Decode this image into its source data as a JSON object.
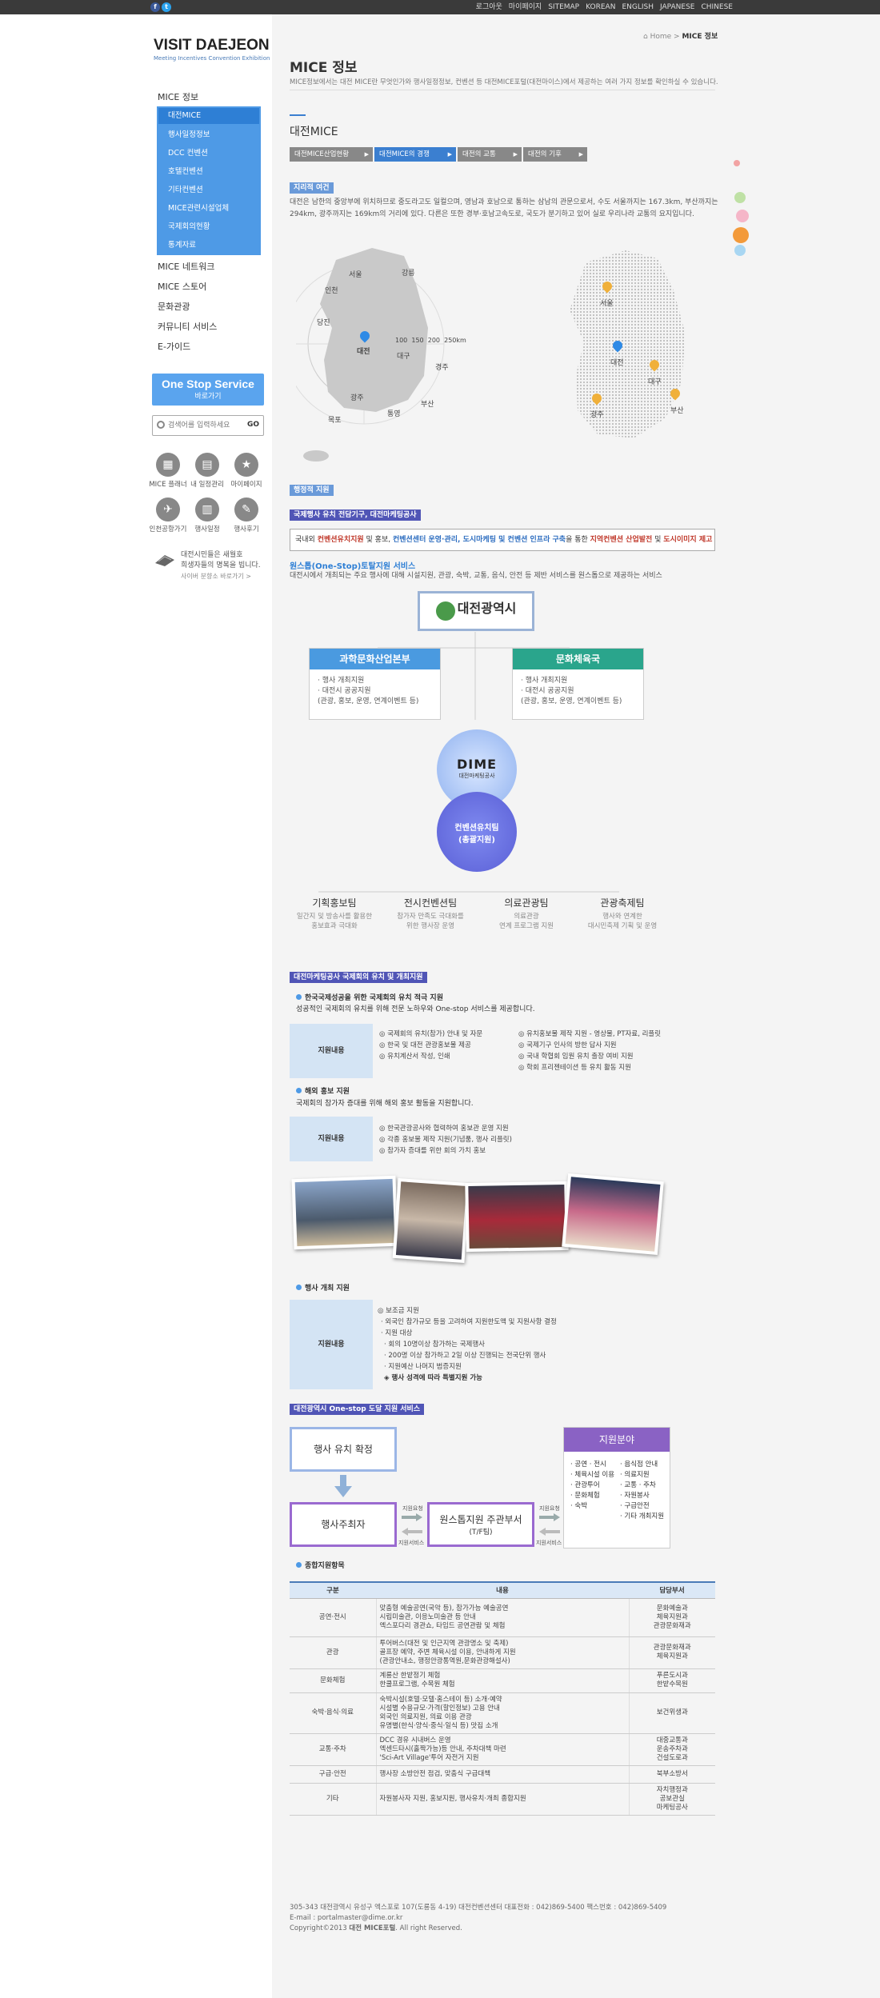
{
  "topbar": {
    "links": [
      "로그아웃",
      "마이페이지",
      "SITEMAP",
      "KOREAN",
      "ENGLISH",
      "JAPANESE",
      "CHINESE"
    ],
    "fb": "f",
    "tw": "t"
  },
  "logo": {
    "title": "VISIT DAEJEON",
    "subtitle": "Meeting Incentives Convention Exhibition"
  },
  "nav": {
    "main": [
      {
        "label": "MICE 정보"
      },
      {
        "label": "MICE 네트워크"
      },
      {
        "label": "MICE 스토어"
      },
      {
        "label": "문화관광"
      },
      {
        "label": "커뮤니티 서비스"
      },
      {
        "label": "E-가이드"
      }
    ],
    "sub": [
      "대전MICE",
      "행사일정정보",
      "DCC 컨벤션",
      "호텔컨벤션",
      "기타컨벤션",
      "MICE관련시설업체",
      "국제회의현황",
      "통계자료"
    ]
  },
  "oss": {
    "title": "One Stop Service",
    "sub": "바로가기"
  },
  "search": {
    "placeholder": "검색어를 입력하세요",
    "go": "GO"
  },
  "quick": [
    {
      "label": "MICE 플래너",
      "icon": "planner-icon"
    },
    {
      "label": "내 일정관리",
      "icon": "schedule-icon"
    },
    {
      "label": "마이페이지",
      "icon": "star-icon"
    },
    {
      "label": "인천공항가기",
      "icon": "plane-icon"
    },
    {
      "label": "행사일정",
      "icon": "calendar-icon"
    },
    {
      "label": "행사후기",
      "icon": "pen-icon"
    }
  ],
  "sidepromo": {
    "l1": "대전시민들은 새월호",
    "l2": "희생자들의 명복을 빕니다.",
    "more": "사이버 분향소 바로가기 >"
  },
  "breadcrumb": {
    "home": "Home",
    "sep": ">",
    "current": "MICE 정보"
  },
  "page": {
    "title": "MICE 정보",
    "desc": "MICE정보에서는 대전 MICE란 무엇인가와 행사일정정보, 컨벤션 등 대전MICE포털(대전마이스)에서 제공하는 여러 가지 정보를 확인하실 수 있습니다.",
    "section": "대전MICE"
  },
  "tabs": [
    "대전MICE산업현황",
    "대전MICE의 경쟁",
    "대전의 교통",
    "대전의 기후"
  ],
  "geo": {
    "badge": "지리적 여건",
    "text1": "대전은 남한의 중앙부에 위치하므로 중도라고도 일컬으며, 영남과 호남으로 통하는 삼남의 관문으로서, 수도 서울까지는 167.3km, 부산까지는",
    "text2": "294km, 광주까지는 169km의 거리에 있다. 다른은 또한 경부·호남고속도로, 국도가 분기하고 있어 실로 우리나라 교통의 요지입니다.",
    "cities1": [
      "서울",
      "강릉",
      "인천",
      "당진",
      "대전",
      "대구",
      "경주",
      "광주",
      "부산",
      "통영",
      "목포"
    ],
    "rings": [
      "100",
      "150",
      "200",
      "250km"
    ],
    "cities2": [
      "서울",
      "대전",
      "대구",
      "광주",
      "부산"
    ]
  },
  "admin": {
    "badge": "행정적 지원",
    "title": "국제행사 유치 전담기구, 대전마케팅공사",
    "box": {
      "a": "국내외 ",
      "b": "컨벤션유치지원",
      "c": " 및 홍보, ",
      "d": "컨벤션센터 운영·관리, 도시마케팅 및 컨벤션 인프라 구축",
      "e": "을 통한 ",
      "f": "지역컨벤션 산업발전",
      "g": " 및 ",
      "h": "도시이미지 제고"
    },
    "ossTitle": "원스톱(One-Stop)토탈지원 서비스",
    "ossDesc": "대전시에서 개최되는 주요 행사에 대해 시설지원, 관광, 숙박, 교통, 음식, 안전 등 제반 서비스를 원스톱으로 제공하는 서비스"
  },
  "org": {
    "top": "대전광역시",
    "left": {
      "title": "과학문화산업본부",
      "items": [
        "· 행사 개최지원",
        "· 대전시 공공지원",
        "(관광, 홍보, 운영, 연계이벤트 등)"
      ]
    },
    "right": {
      "title": "문화체육국",
      "items": [
        "· 행사 개최지원",
        "· 대전시 공공지원",
        "(관광, 홍보, 운영, 연계이벤트 등)"
      ]
    },
    "dime": "DIME",
    "dimesub": "대전마케팅공사",
    "center1": "컨벤션유치팀",
    "center2": "(총괄지원)",
    "teams": [
      {
        "n": "기획홍보팀",
        "d1": "일간지 및 방송사를 활용한",
        "d2": "홍보효과 극대화"
      },
      {
        "n": "전시컨벤션팀",
        "d1": "참가자 만족도 극대화를",
        "d2": "위한 행사장 운영"
      },
      {
        "n": "의료관광팀",
        "d1": "의료관광",
        "d2": "연계 프로그램 지원"
      },
      {
        "n": "관광축제팀",
        "d1": "행사와 연계한",
        "d2": "대시민축제 기획 및 운영"
      }
    ]
  },
  "intl": {
    "badge": "대전마케팅공사 국제회의 유치 및 개최지원",
    "s1": {
      "title": "한국국제성공을 위한 국제회의 유치 적극 지원",
      "desc": "성공적인 국제회의 유치를 위해 전문 노하우와 One-stop 서비스를 제공합니다.",
      "label": "지원내용",
      "colA": [
        "◎ 국제회의 유치(참가) 안내 및 자문",
        "◎ 한국 및 대전 관광홍보물 제공",
        "◎ 유치계산서 작성, 인쇄"
      ],
      "colB": [
        "◎ 유치홍보물 제작 지원 - 영상물, PT자료, 리플릿",
        "◎ 국제기구 인사의 방한 답사 지원",
        "◎ 국내 학협회 임원 유치 출장 여비 지원",
        "◎ 학회 프리젠테이션 등 유치 활동 지원"
      ]
    },
    "s2": {
      "title": "해외 홍보 지원",
      "desc": "국제회의 참가자 증대를 위해 해외 홍보 활동을 지원합니다.",
      "label": "지원내용",
      "items": [
        "◎ 한국관광공사와 협력하여 홍보관 운영 지원",
        "◎ 각종 홍보물 제작 지원(기념품, 행사 리플릿)",
        "◎ 참가자 증대를 위한 회의 가치 홍보"
      ]
    },
    "s3": {
      "title": "행사 개최 지원",
      "label": "지원내용",
      "items": [
        "◎ 보조금 지원",
        "· 외국인 참가규모 등을 고려하여 지원한도액 및 지원사항 결정",
        "· 지원 대상",
        "· 회의 10명이상 참가하는 국제행사",
        "· 200명 이상 참가하고 2일 이상 진행되는 전국단위 행사",
        "· 지원예산 나머지 범증지원",
        "◈ 행사 성격에 따라 특별지원 가능"
      ]
    }
  },
  "flowsec": {
    "badge": "대전광역시 One-stop 도달 지원 서비스",
    "b1": "행사 유치 확정",
    "b2": "행사주최자",
    "b3": "원스톱지원 주관부서",
    "b3s": "(T/F팀)",
    "b4": "지원분야",
    "l1": "지원요청",
    "l2": "지원서비스",
    "l3": "지원요청",
    "l4": "지원서비스",
    "listA": [
      "· 공연 · 전시",
      "· 체육시설 이용",
      "· 관광투어",
      "· 문화체험",
      "· 숙박"
    ],
    "listB": [
      "· 음식점 안내",
      "· 의료지원",
      "· 교통 · 주차",
      "· 자원봉사",
      "· 구급안전",
      "· 기타 개최지원"
    ]
  },
  "table": {
    "title": "종합지원항목",
    "headers": [
      "구분",
      "내용",
      "담당부서"
    ],
    "rows": [
      {
        "cat": "공연·전시",
        "lines": [
          "맞춤형 예술공연(국악 등), 참가가능 예술공연",
          "시립미술관, 이응노미술관 등 안내",
          "엑스포다리 경관쇼, 타임드 공연관람 및 체험"
        ],
        "dept": [
          "문화예술과",
          "체육지원과",
          "관광문화재과"
        ]
      },
      {
        "cat": "관광",
        "lines": [
          "투어버스(대전 및 인근지역 관광명소 및 축제)",
          "골프장 예약, 주변 체육시설 이용, 안내하게 지원",
          "(관광안내소, 행정안광통역원,문화관광해설사)"
        ],
        "dept": [
          "관광문화재과",
          "체육지원과"
        ]
      },
      {
        "cat": "문화체험",
        "lines": [
          "계룡산 한밭정기 체험",
          "한쿨프로그램, 수목원 체험"
        ],
        "dept": [
          "푸른도시과",
          "한밭수목원"
        ]
      },
      {
        "cat": "숙박·음식·의료",
        "lines": [
          "숙박시설(호텔·모텔·홈스테이 등) 소개·예약",
          "시설별 수용규모·가격(할인정보) 고용 안내",
          "외국인 의료지원, 의료 이용 관광",
          "유명별(한식·양식·중식·일식 등) 맛집 소개"
        ],
        "dept": [
          "보건위생과"
        ]
      },
      {
        "cat": "교통·주차",
        "lines": [
          "DCC 경유 시내버스 운영",
          "엑센드타시(홀짝가능)등 안내, 주차대책 마련",
          "'Sci-Art Village'투어 자전거 지원"
        ],
        "dept": [
          "대중교통과",
          "운송주차과",
          "건설도로과"
        ]
      },
      {
        "cat": "구급·안전",
        "lines": [
          "행사장 소방안전 점검, 맞춤식 구급대책"
        ],
        "dept": [
          "북부소방서"
        ]
      },
      {
        "cat": "기타",
        "lines": [
          "자원봉사자 지원, 홍보지원, 행사유치·개최 종합지원"
        ],
        "dept": [
          "자치행정과",
          "공보관실",
          "마케팅공사"
        ]
      }
    ]
  },
  "footer": {
    "l1": "305-343 대전광역시 유성구 엑스포로 107(도룡동 4-19) 대전컨벤션센터 대표전화 : 042)869-5400 팩스번호 : 042)869-5409",
    "l2": "E-mail : portalmaster@dime.or.kr",
    "l3a": "Copyright©2013 ",
    "l3b": "대전 MICE포털",
    "l3c": ". All right Reserved."
  },
  "colors": {
    "accent": "#3b7fd0",
    "sub": "#4e9ae6",
    "badge": "#6a9ad9",
    "badgeDark": "#5055b6",
    "green": "#2aa58c",
    "purple": "#8a62c4"
  }
}
